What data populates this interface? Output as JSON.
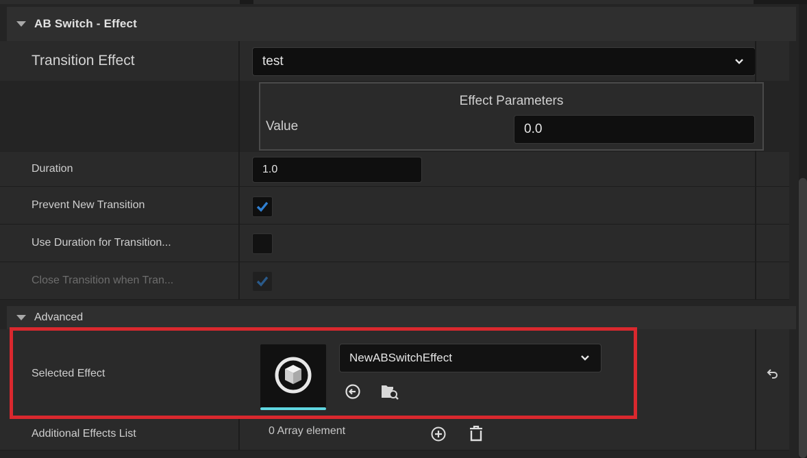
{
  "category": {
    "title": "AB Switch - Effect"
  },
  "transition_effect": {
    "label": "Transition Effect",
    "value": "test"
  },
  "effect_parameters": {
    "title": "Effect Parameters",
    "value_label": "Value",
    "value": "0.0"
  },
  "duration": {
    "label": "Duration",
    "value": "1.0"
  },
  "prevent_new_transition": {
    "label": "Prevent New Transition",
    "checked": true
  },
  "use_duration": {
    "label": "Use Duration for Transition...",
    "checked": false
  },
  "close_transition": {
    "label": "Close Transition when Tran...",
    "checked": true,
    "disabled": true
  },
  "advanced": {
    "title": "Advanced"
  },
  "selected_effect": {
    "label": "Selected Effect",
    "value": "NewABSwitchEffect"
  },
  "additional_effects": {
    "label": "Additional Effects List",
    "value": "0 Array element"
  },
  "colors": {
    "highlight": "#d9282e",
    "check_blue": "#2f7fd1",
    "thumb_bar": "#5fd6e0"
  }
}
